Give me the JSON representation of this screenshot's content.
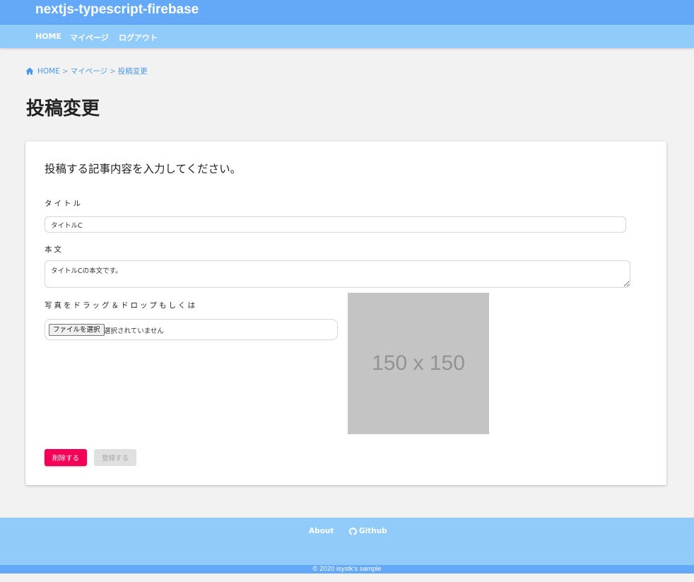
{
  "header": {
    "site_title": "nextjs-typescript-firebase",
    "nav": [
      "HOME",
      "マイページ",
      "ログアウト"
    ]
  },
  "breadcrumb": {
    "items": [
      "HOME",
      "マイページ",
      "投稿変更"
    ],
    "separator": ">",
    "icon": "home-icon"
  },
  "page": {
    "title": "投稿変更"
  },
  "form": {
    "heading": "投稿する記事内容を入力してください。",
    "title_label": "タイトル",
    "title_value": "タイトルC",
    "body_label": "本文",
    "body_value": "タイトルCの本文です。",
    "image_label": "写真をドラッグ＆ドロップもしくは",
    "file_button_label": "ファイルを選択",
    "file_status": "選択されていません",
    "preview_placeholder": "150 x 150",
    "delete_button": "削除する",
    "register_button": "登録する"
  },
  "footer": {
    "links": [
      "About",
      "Github"
    ],
    "github_icon": "github-icon",
    "copyright": "© 2020 isystk's sample"
  },
  "colors": {
    "header_primary": "#64a8f8",
    "header_secondary": "#90cbfa",
    "accent_delete": "#f50057",
    "disabled_button": "#e0e0e0",
    "link": "#4a98ea"
  }
}
